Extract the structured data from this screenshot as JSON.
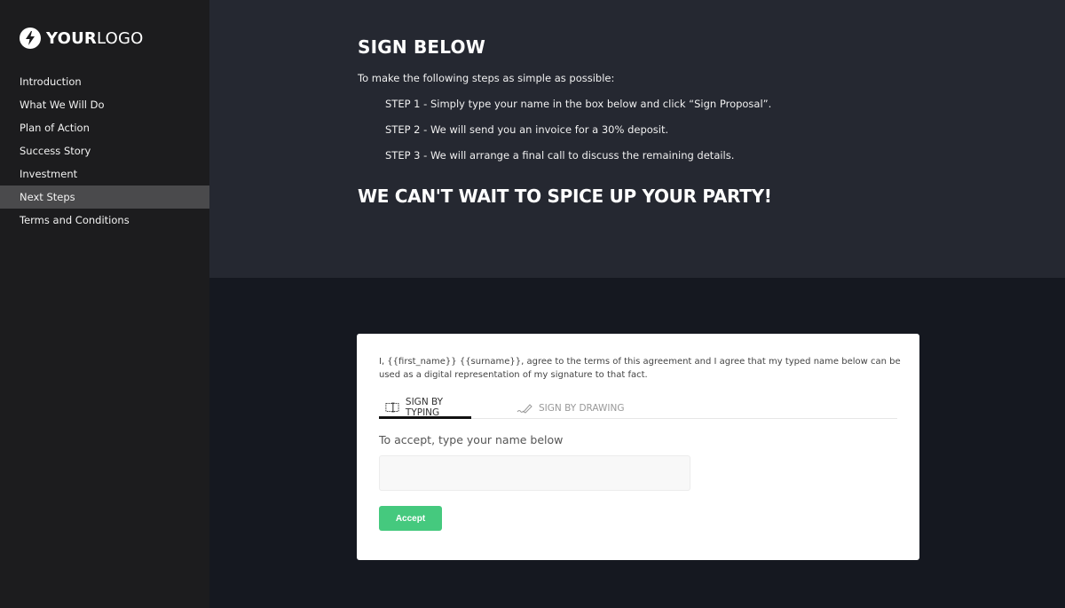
{
  "logo": {
    "bold": "YOUR",
    "light": "LOGO",
    "icon": "lightning-bolt-icon"
  },
  "sidebar": {
    "items": [
      {
        "label": "Introduction",
        "active": false
      },
      {
        "label": "What We Will Do",
        "active": false
      },
      {
        "label": "Plan of Action",
        "active": false
      },
      {
        "label": "Success Story",
        "active": false
      },
      {
        "label": "Investment",
        "active": false
      },
      {
        "label": "Next Steps",
        "active": true
      },
      {
        "label": "Terms and Conditions",
        "active": false
      }
    ]
  },
  "main": {
    "heading": "SIGN BELOW",
    "intro": "To make the following steps as simple as possible:",
    "steps": [
      "STEP 1 - Simply type your name in the box below and click “Sign Proposal”.",
      "STEP 2 - We will send you an invoice for a 30% deposit.",
      "STEP 3 - We will arrange a final call to discuss the remaining details."
    ],
    "tagline": "WE CAN'T WAIT TO SPICE UP YOUR PARTY!"
  },
  "signature": {
    "agreement": "I, {{first_name}} {{surname}}, agree to the terms of this agreement and I agree that my typed name below can be used as a digital representation of my signature to that fact.",
    "tabs": [
      {
        "label": "SIGN BY TYPING",
        "icon": "text-cursor-icon",
        "active": true
      },
      {
        "label": "SIGN BY DRAWING",
        "icon": "pen-icon",
        "active": false
      }
    ],
    "input_label": "To accept, type your name below",
    "input_value": "",
    "input_placeholder": "",
    "accept_label": "Accept"
  },
  "colors": {
    "sidebar_bg": "#1c1c1e",
    "top_panel_bg": "#252831",
    "bottom_bg": "#151820",
    "active_nav_bg": "#4a4a4c",
    "accept_green": "#45c97e"
  }
}
